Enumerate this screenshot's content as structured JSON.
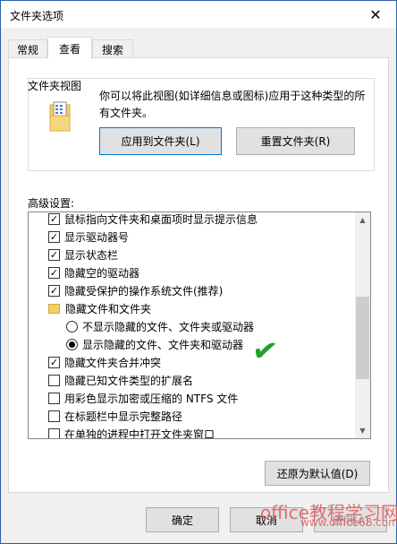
{
  "window": {
    "title": "文件夹选项",
    "close_glyph": "✕"
  },
  "tabs": [
    {
      "label": "常规"
    },
    {
      "label": "查看"
    },
    {
      "label": "搜索"
    }
  ],
  "folder_views": {
    "legend": "文件夹视图",
    "description": "你可以将此视图(如详细信息或图标)应用于这种类型的所有文件夹。",
    "apply_button": "应用到文件夹(L)",
    "reset_button": "重置文件夹(R)"
  },
  "advanced": {
    "label": "高级设置:",
    "items": [
      {
        "type": "checkbox",
        "checked": true,
        "label": "鼠标指向文件夹和桌面项时显示提示信息"
      },
      {
        "type": "checkbox",
        "checked": true,
        "label": "显示驱动器号"
      },
      {
        "type": "checkbox",
        "checked": true,
        "label": "显示状态栏"
      },
      {
        "type": "checkbox",
        "checked": true,
        "label": "隐藏空的驱动器"
      },
      {
        "type": "checkbox",
        "checked": true,
        "label": "隐藏受保护的操作系统文件(推荐)"
      },
      {
        "type": "folder",
        "label": "隐藏文件和文件夹"
      },
      {
        "type": "radio",
        "checked": false,
        "label": "不显示隐藏的文件、文件夹或驱动器"
      },
      {
        "type": "radio",
        "checked": true,
        "label": "显示隐藏的文件、文件夹和驱动器"
      },
      {
        "type": "checkbox",
        "checked": true,
        "label": "隐藏文件夹合并冲突"
      },
      {
        "type": "checkbox",
        "checked": false,
        "label": "隐藏已知文件类型的扩展名"
      },
      {
        "type": "checkbox",
        "checked": false,
        "label": "用彩色显示加密或压缩的 NTFS 文件"
      },
      {
        "type": "checkbox",
        "checked": false,
        "label": "在标题栏中显示完整路径"
      },
      {
        "type": "checkbox",
        "checked": false,
        "label": "在单独的进程中打开文件夹窗口"
      }
    ]
  },
  "restore_defaults": "还原为默认值(D)",
  "footer": {
    "ok": "确定",
    "cancel": "取消",
    "apply": "应用(A)"
  },
  "watermark": {
    "line1": "office教程学习网",
    "line2": "www.office68.com"
  },
  "colors": {
    "accent": "#0078d7",
    "check_green": "#22a12a",
    "watermark": "#e05a5a"
  }
}
